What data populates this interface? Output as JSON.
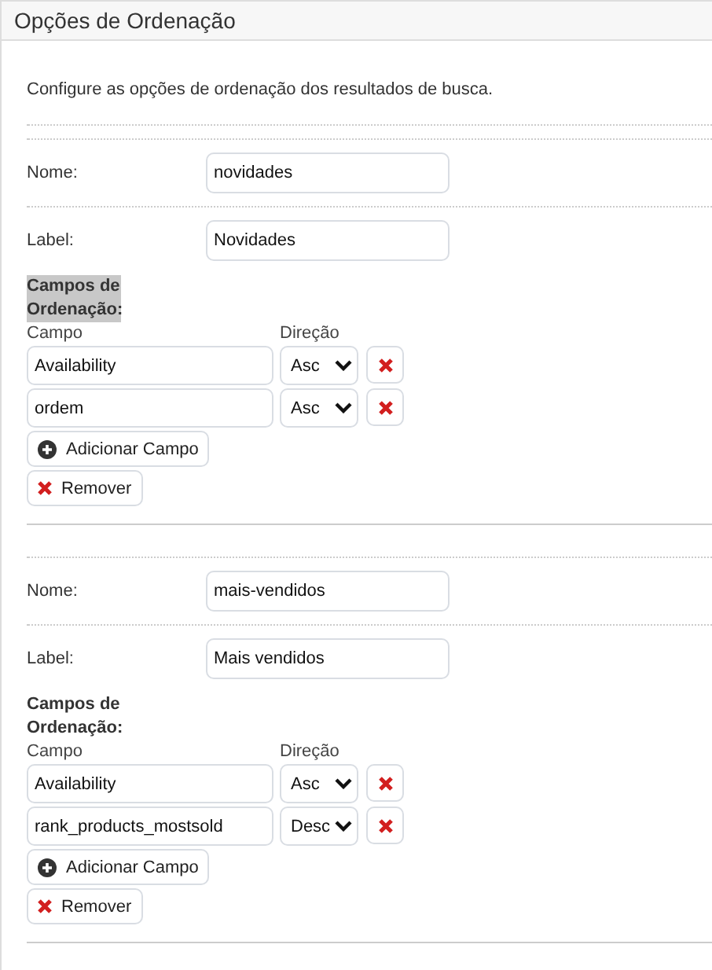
{
  "panel": {
    "title": "Opções de Ordenação",
    "description": "Configure as opções de ordenação dos resultados de busca."
  },
  "sort_options": [
    {
      "name_label": "Nome:",
      "name_value": "novidades",
      "label_label": "Label:",
      "label_value": "Novidades",
      "fields_heading": "Campos de Ordenação:",
      "fields_heading_highlighted": true,
      "field_column": "Campo",
      "direction_column": "Direção",
      "fields": [
        {
          "field": "Availability",
          "direction": "Asc"
        },
        {
          "field": "ordem",
          "direction": "Asc"
        }
      ],
      "add_button": "Adicionar Campo",
      "remove_button": "Remover"
    },
    {
      "name_label": "Nome:",
      "name_value": "mais-vendidos",
      "label_label": "Label:",
      "label_value": "Mais vendidos",
      "fields_heading": "Campos de Ordenação:",
      "fields_heading_highlighted": false,
      "field_column": "Campo",
      "direction_column": "Direção",
      "fields": [
        {
          "field": "Availability",
          "direction": "Asc"
        },
        {
          "field": "rank_products_mostsold",
          "direction": "Desc"
        }
      ],
      "add_button": "Adicionar Campo",
      "remove_button": "Remover"
    }
  ]
}
